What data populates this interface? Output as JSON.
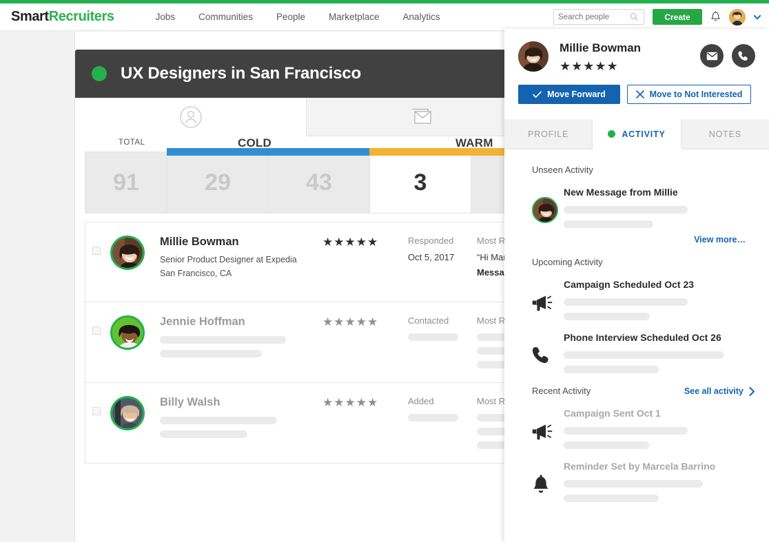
{
  "header": {
    "logo_smart": "Smart",
    "logo_recruiters": "Recruiters",
    "nav": [
      {
        "label": "Jobs"
      },
      {
        "label": "Communities"
      },
      {
        "label": "People"
      },
      {
        "label": "Marketplace"
      },
      {
        "label": "Analytics"
      }
    ],
    "search": {
      "placeholder": "Search people",
      "value": ""
    },
    "create_label": "Create"
  },
  "main": {
    "title": "UX Designers in San Francisco",
    "tabs": [
      {
        "icon": "person-icon",
        "active": true
      },
      {
        "icon": "envelope-icon",
        "active": false
      },
      {
        "icon": "activity-chart-icon",
        "active": false
      }
    ],
    "funnel": {
      "groups": [
        {
          "label": "TOTAL",
          "style": "small"
        },
        {
          "label": "COLD",
          "style": "big"
        },
        {
          "label": "WARM",
          "style": "big"
        }
      ],
      "columns": [
        {
          "value": "91",
          "bar": "none",
          "highlight": false
        },
        {
          "value": "29",
          "bar": "blue",
          "highlight": false
        },
        {
          "value": "43",
          "bar": "blue",
          "highlight": false
        },
        {
          "value": "3",
          "bar": "amber",
          "highlight": true
        },
        {
          "value": "",
          "bar": "amber",
          "highlight": false
        }
      ],
      "bar_colors": {
        "blue": "#2e8fd1",
        "amber": "#f2b234"
      }
    },
    "rows": [
      {
        "name": "Millie Bowman",
        "title": "Senior Product Designer at Expedia",
        "location": "San Francisco, CA",
        "stars": "★★★★★",
        "status_label": "Responded",
        "status_date": "Oct 5, 2017",
        "recent_label": "Most Recent",
        "recent_quote": "“Hi Marcela,",
        "recent_msg": "Message fro",
        "muted": false
      },
      {
        "name": "Jennie Hoffman",
        "title": "",
        "location": "",
        "stars": "★★★★★",
        "status_label": "Contacted",
        "status_date": "",
        "recent_label": "Most Recent",
        "recent_quote": "",
        "recent_msg": "",
        "muted": true
      },
      {
        "name": "Billy Walsh",
        "title": "",
        "location": "",
        "stars": "★★★★★",
        "status_label": "Added",
        "status_date": "",
        "recent_label": "Most Recent",
        "recent_quote": "",
        "recent_msg": "",
        "muted": true
      }
    ]
  },
  "panel": {
    "candidate_name": "Millie Bowman",
    "stars": "★★★★★",
    "move_forward_label": "Move Forward",
    "not_interested_label": "Move to Not Interested",
    "tabs": [
      {
        "label": "PROFILE",
        "active": false,
        "dot": false
      },
      {
        "label": "ACTIVITY",
        "active": true,
        "dot": true
      },
      {
        "label": "NOTES",
        "active": false,
        "dot": false
      }
    ],
    "sections": [
      {
        "heading": "Unseen Activity",
        "see_all": "",
        "items": [
          {
            "icon": "avatar-icon",
            "title": "New Message from Millie",
            "muted": false
          }
        ],
        "view_more": "View more…"
      },
      {
        "heading": "Upcoming Activity",
        "see_all": "",
        "items": [
          {
            "icon": "megaphone-icon",
            "title": "Campaign Scheduled Oct 23",
            "muted": false
          },
          {
            "icon": "phone-icon",
            "title": "Phone Interview Scheduled Oct 26",
            "muted": false
          }
        ],
        "view_more": ""
      },
      {
        "heading": "Recent Activity",
        "see_all": "See all activity",
        "items": [
          {
            "icon": "megaphone-icon",
            "title": "Campaign Sent Oct 1",
            "muted": true
          },
          {
            "icon": "bell-icon",
            "title": "Reminder Set by Marcela Barrino",
            "muted": true
          }
        ],
        "view_more": ""
      }
    ]
  },
  "colors": {
    "brand_green": "#23b14d",
    "accent_blue": "#1463b0",
    "cold_blue": "#2e8fd1",
    "warm_amber": "#f2b234",
    "dark_bar": "#414141"
  }
}
